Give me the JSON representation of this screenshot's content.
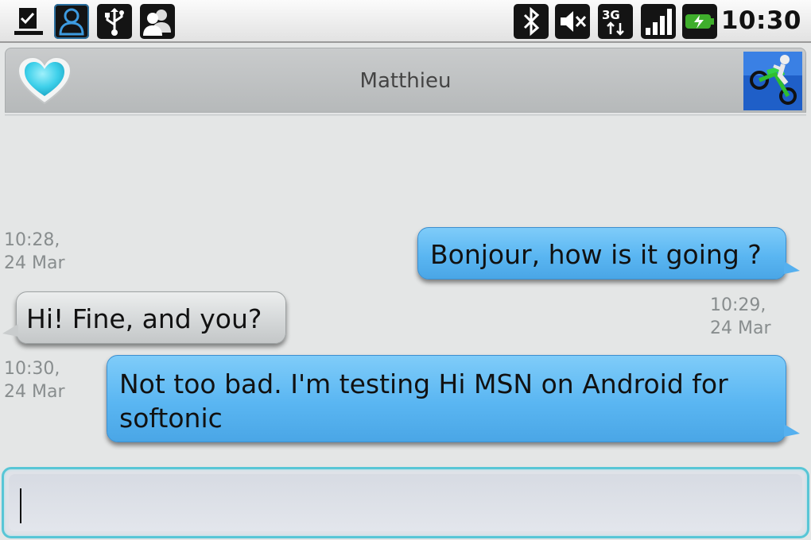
{
  "status_bar": {
    "left_icons": [
      "download-complete-icon",
      "contact-presence-icon",
      "usb-icon",
      "contacts-icon"
    ],
    "right_icons": [
      "bluetooth-icon",
      "muted-speaker-icon",
      "3g-data-icon",
      "signal-icon",
      "battery-charging-icon"
    ],
    "network_label": "3G",
    "time": "10:30"
  },
  "header": {
    "status_icon": "heart-icon",
    "contact_name": "Matthieu",
    "avatar_icon": "motocross-avatar-image"
  },
  "messages": [
    {
      "direction": "outgoing",
      "text": "Bonjour, how is it going ?",
      "timestamp_time": "10:28,",
      "timestamp_date": "24 Mar"
    },
    {
      "direction": "incoming",
      "text": "Hi! Fine, and you?",
      "timestamp_time": "10:29,",
      "timestamp_date": "24 Mar"
    },
    {
      "direction": "outgoing",
      "text": "Not too bad. I'm testing Hi MSN on Android for softonic",
      "timestamp_time": "10:30,",
      "timestamp_date": "24 Mar"
    }
  ],
  "compose": {
    "value": "",
    "placeholder": ""
  },
  "colors": {
    "outgoing_bubble": "#5ab6f2",
    "incoming_bubble": "#d3d6d7",
    "compose_focus": "#58c6d6",
    "heart": "#4fd0e6"
  }
}
